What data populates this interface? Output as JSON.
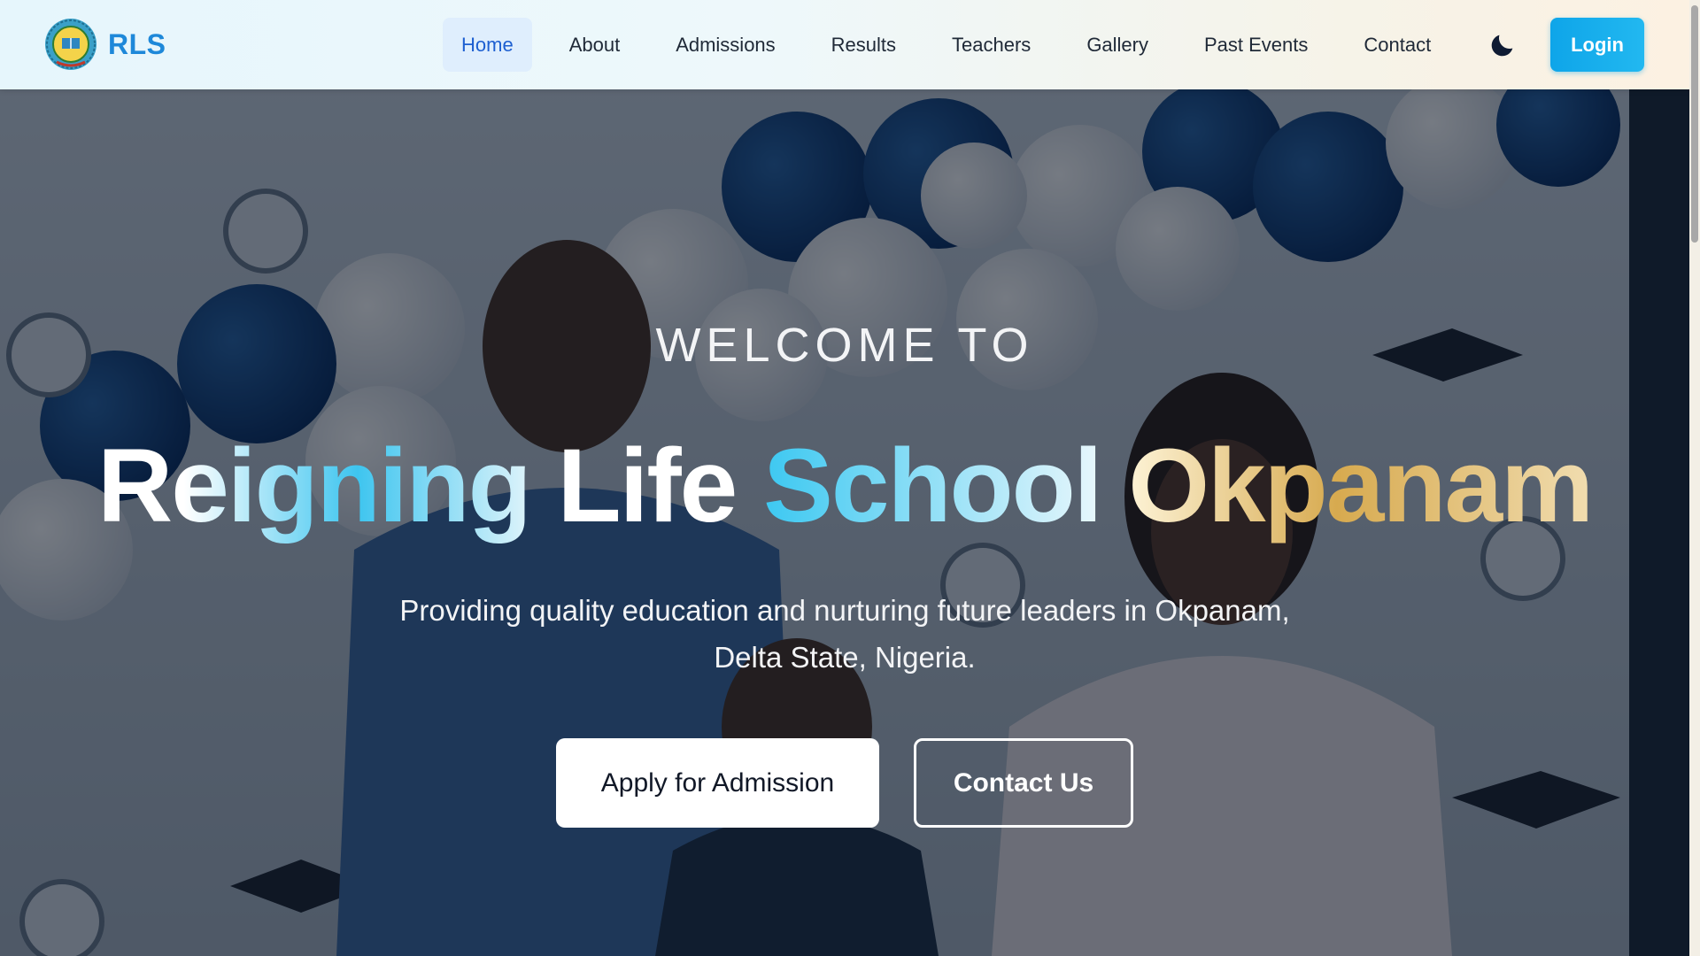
{
  "brand": {
    "name": "RLS",
    "logo_icon": "school-crest-logo-icon"
  },
  "nav": {
    "items": [
      {
        "label": "Home",
        "active": true
      },
      {
        "label": "About",
        "active": false
      },
      {
        "label": "Admissions",
        "active": false
      },
      {
        "label": "Results",
        "active": false
      },
      {
        "label": "Teachers",
        "active": false
      },
      {
        "label": "Gallery",
        "active": false
      },
      {
        "label": "Past Events",
        "active": false
      },
      {
        "label": "Contact",
        "active": false
      }
    ],
    "theme_toggle_icon": "moon-icon",
    "login_label": "Login"
  },
  "hero": {
    "welcome": "WELCOME TO",
    "headline": {
      "word1": "Reigning",
      "word2": "Life",
      "word3": "School",
      "word4": "Okpanam"
    },
    "subtitle": "Providing quality education and nurturing future leaders in Okpanam, Delta State, Nigeria.",
    "primary_button": "Apply for Admission",
    "secondary_button": "Contact Us",
    "background_image": "graduation-prize-giving-ceremony-photo"
  },
  "colors": {
    "brand_blue": "#1e88d9",
    "active_nav_bg": "#dfeefd",
    "login_bg": "#0ea5e9",
    "headline_cyan": "#3ec5ef",
    "headline_gold": "#d7aa4f"
  }
}
